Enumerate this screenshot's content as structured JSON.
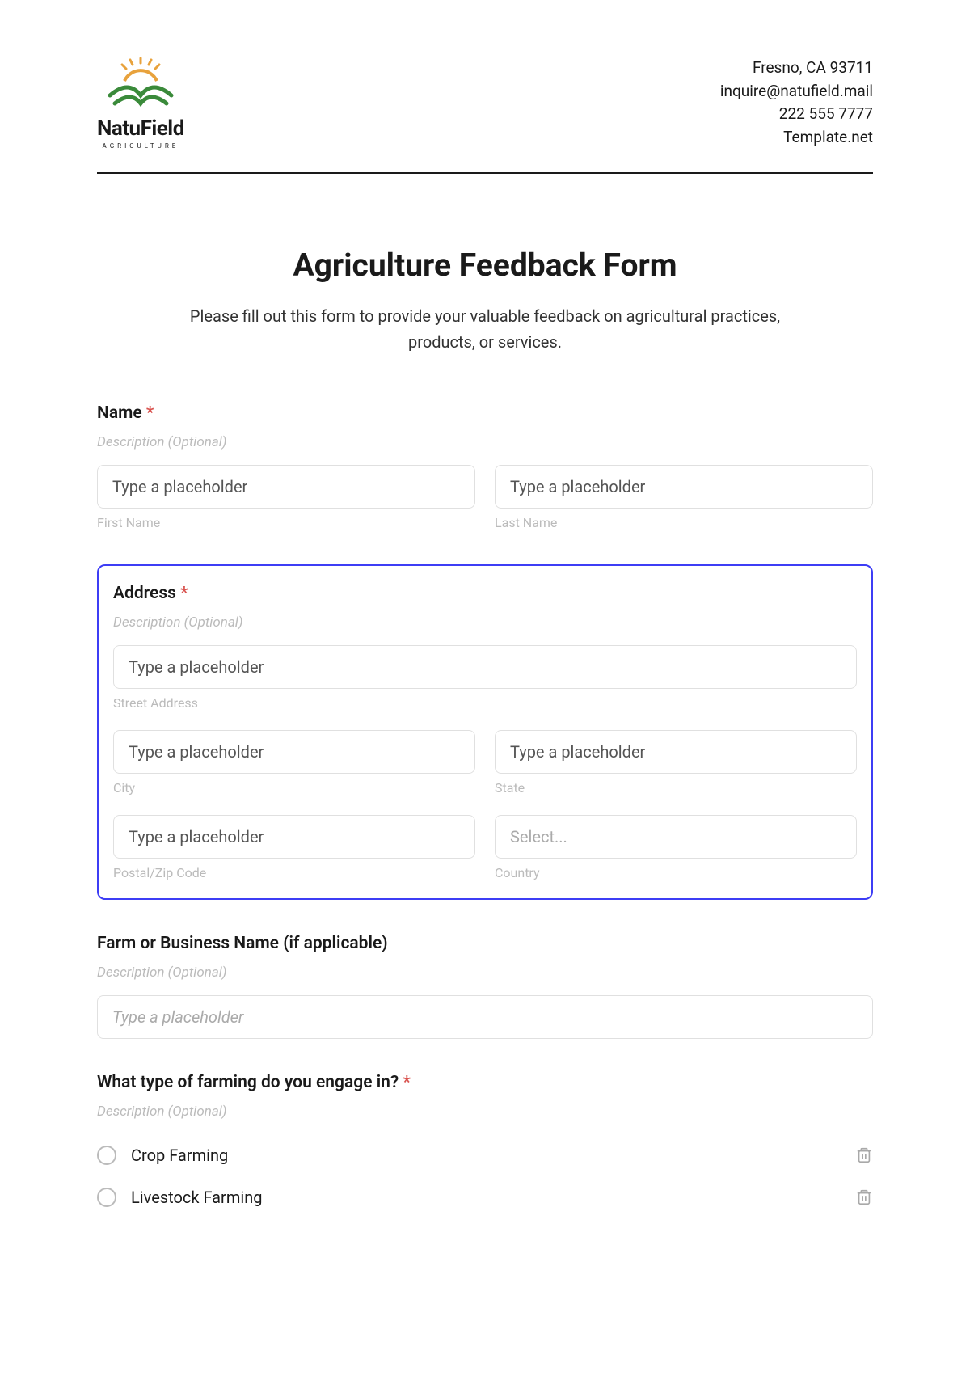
{
  "header": {
    "brand_name": "NatuField",
    "brand_tagline": "AGRICULTURE",
    "contact": {
      "line1": "Fresno, CA 93711",
      "line2": "inquire@natufield.mail",
      "line3": "222 555 7777",
      "line4": "Template.net"
    }
  },
  "title": "Agriculture Feedback Form",
  "subtitle": "Please fill out this form to provide your valuable feedback on agricultural practices, products, or services.",
  "sections": {
    "name": {
      "label": "Name",
      "required": "*",
      "description": "Description (Optional)",
      "first_placeholder": "Type a placeholder",
      "first_sublabel": "First Name",
      "last_placeholder": "Type a placeholder",
      "last_sublabel": "Last Name"
    },
    "address": {
      "label": "Address",
      "required": "*",
      "description": "Description (Optional)",
      "street_placeholder": "Type a placeholder",
      "street_sublabel": "Street Address",
      "city_placeholder": "Type a placeholder",
      "city_sublabel": "City",
      "state_placeholder": "Type a placeholder",
      "state_sublabel": "State",
      "postal_placeholder": "Type a placeholder",
      "postal_sublabel": "Postal/Zip Code",
      "country_placeholder": "Select...",
      "country_sublabel": "Country"
    },
    "business": {
      "label": "Farm or Business Name (if applicable)",
      "description": "Description (Optional)",
      "placeholder": "Type a placeholder"
    },
    "farming_type": {
      "label": "What type of farming do you engage in?",
      "required": "*",
      "description": "Description (Optional)",
      "options": [
        "Crop Farming",
        "Livestock Farming"
      ]
    }
  }
}
